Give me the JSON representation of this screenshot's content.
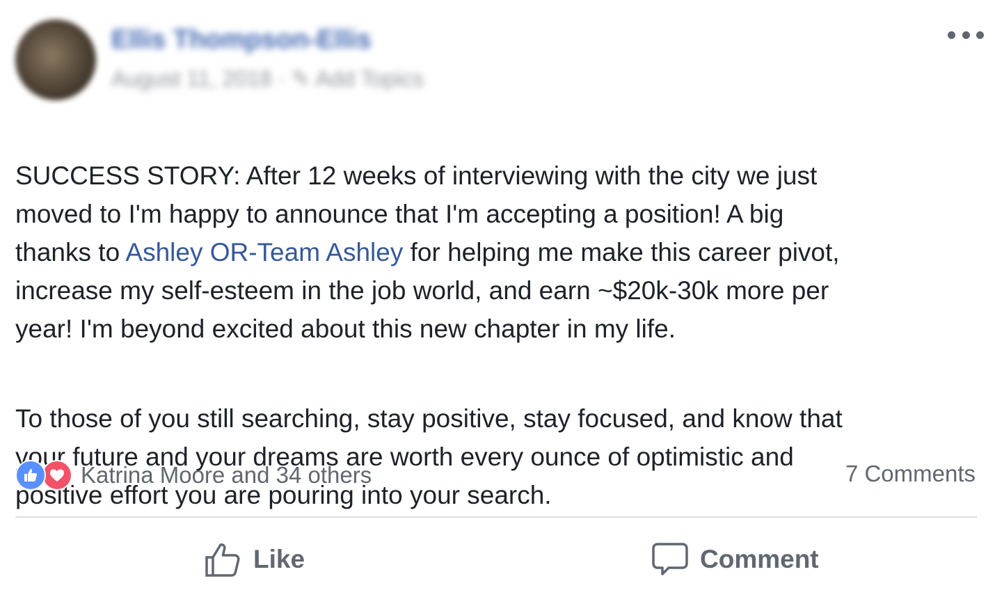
{
  "post": {
    "author": "Ellis Thompson-Ellis",
    "meta": "August 11, 2018 · ✎ Add Topics",
    "paragraph1_before_mention": "SUCCESS STORY: After 12 weeks of interviewing with the city we just\nmoved to I'm happy to announce that I'm accepting a position! A big\nthanks to ",
    "mention": "Ashley OR-Team Ashley",
    "paragraph1_after_mention": " for helping me make this career pivot,\nincrease my self-esteem in the job world, and earn ~$20k-30k more per\nyear! I'm beyond excited about this new chapter in my life.",
    "paragraph2": "To those of you still searching, stay positive, stay focused, and know that\nyour future and your dreams are worth every ounce of optimistic and\npositive effort you are pouring into your search."
  },
  "reactions": {
    "summary": "Katrina Moore and 34 others",
    "types": [
      "like-reaction-icon",
      "love-reaction-icon"
    ],
    "like_color": "#5890ff",
    "love_color": "#f25268"
  },
  "comments": {
    "count_label": "7 Comments"
  },
  "actions": {
    "like_label": "Like",
    "comment_label": "Comment"
  },
  "colors": {
    "link": "#365899",
    "text": "#1d2129",
    "secondary": "#606770"
  }
}
